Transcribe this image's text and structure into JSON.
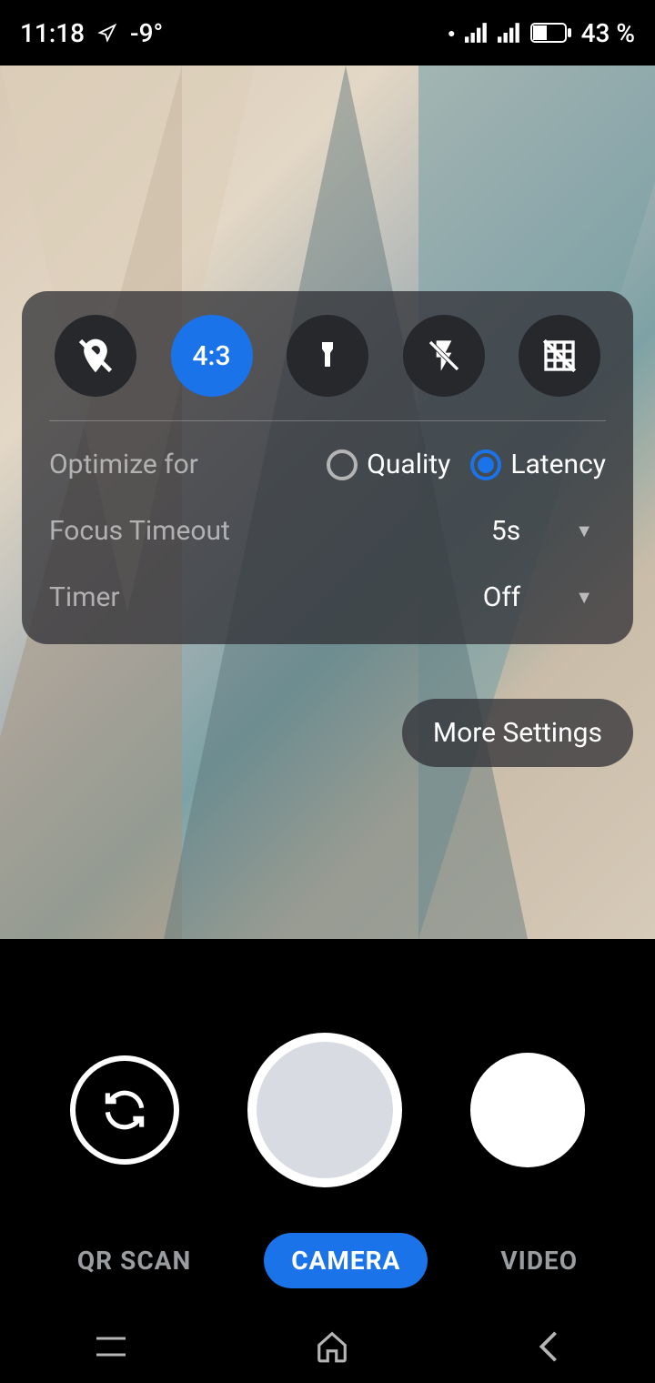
{
  "statusbar": {
    "time": "11:18",
    "temperature": "-9°",
    "battery": "43 %"
  },
  "quick": {
    "aspect": "4:3"
  },
  "settings": {
    "optimize_label": "Optimize for",
    "optimize_options": {
      "quality": "Quality",
      "latency": "Latency"
    },
    "optimize_selected": "latency",
    "focus_label": "Focus Timeout",
    "focus_value": "5s",
    "timer_label": "Timer",
    "timer_value": "Off",
    "more": "More Settings"
  },
  "modes": {
    "qr": "QR SCAN",
    "camera": "CAMERA",
    "video": "VIDEO",
    "active": "camera"
  }
}
